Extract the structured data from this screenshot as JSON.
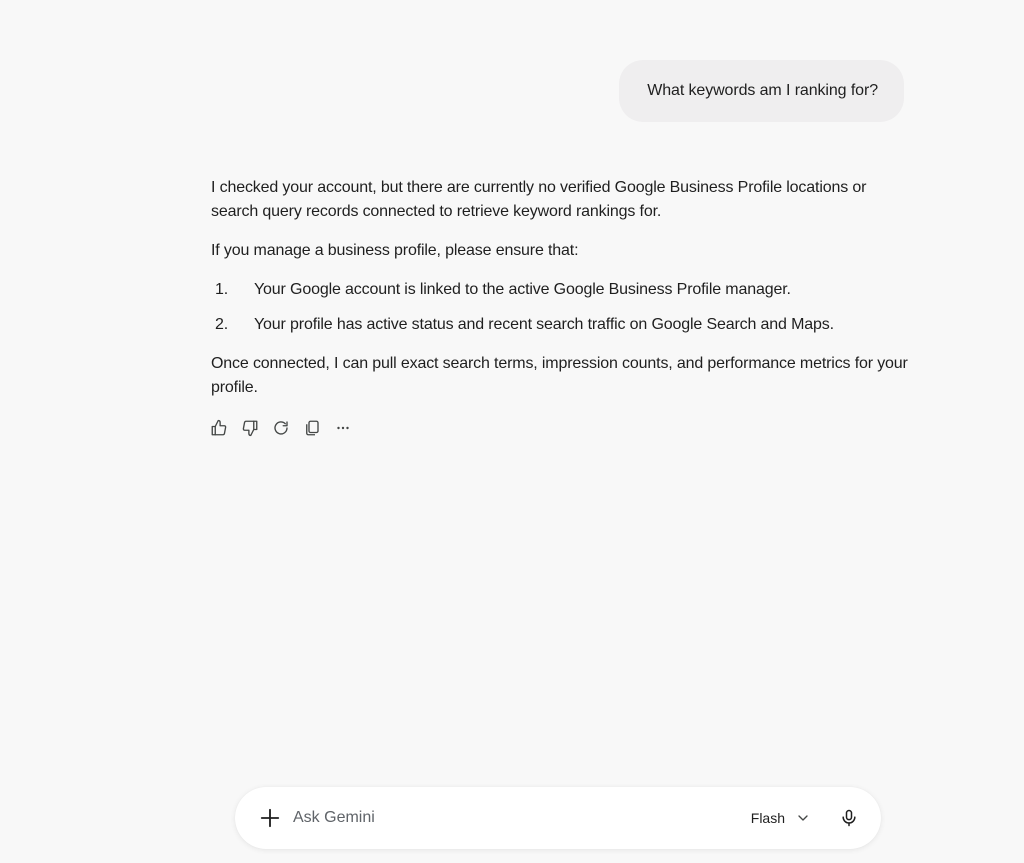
{
  "conversation": {
    "user_message": "What keywords am I ranking for?",
    "response": {
      "paragraph1": "I checked your account, but there are currently no verified Google Business Profile locations or search query records connected to retrieve keyword rankings for.",
      "paragraph2": "If you manage a business profile, please ensure that:",
      "list": [
        {
          "num": "1.",
          "text": "Your Google account is linked to the active Google Business Profile manager."
        },
        {
          "num": "2.",
          "text": "Your profile has active status and recent search traffic on Google Search and Maps."
        }
      ],
      "paragraph3": "Once connected, I can pull exact search terms, impression counts, and performance metrics for your profile."
    },
    "actions": [
      "thumbs-up-icon",
      "thumbs-down-icon",
      "refresh-icon",
      "copy-icon",
      "more-options-icon"
    ]
  },
  "composer": {
    "placeholder": "Ask Gemini",
    "model": "Flash"
  },
  "colors": {
    "background": "#f8f8f8",
    "user_bubble": "#efeeef",
    "composer_bg": "#ffffff"
  }
}
